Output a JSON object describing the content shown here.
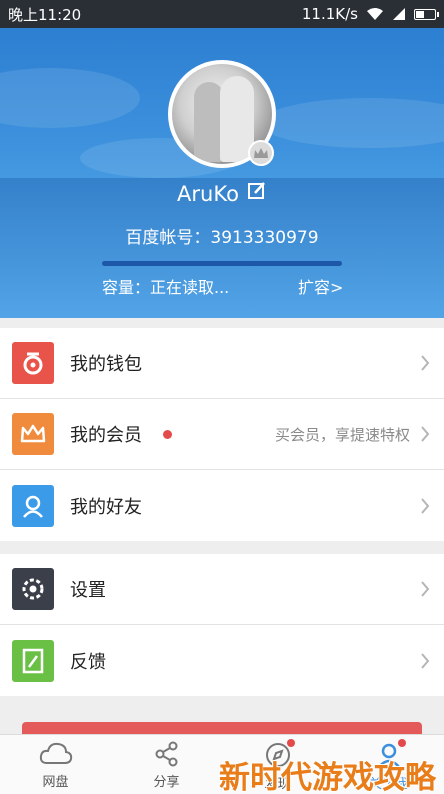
{
  "status_bar": {
    "time": "晚上11:20",
    "network_speed": "11.1K/s",
    "icons": [
      "wifi-icon",
      "signal-icon",
      "battery-icon"
    ]
  },
  "profile": {
    "username": "AruKo",
    "account_label": "百度帐号：3913330979",
    "quota_label": "容量：正在读取...",
    "expand_label": "扩容>",
    "quota_progress": 1.0,
    "quota_color": "#1d57a8"
  },
  "menu_group_1": [
    {
      "label": "我的钱包",
      "icon": "wallet-icon",
      "color": "#e8534a",
      "hint": "",
      "dot": false
    },
    {
      "label": "我的会员",
      "icon": "crown-icon",
      "color": "#f08a3c",
      "hint": "买会员，享提速特权",
      "dot": true
    },
    {
      "label": "我的好友",
      "icon": "friend-icon",
      "color": "#3b9be8",
      "hint": "",
      "dot": false
    }
  ],
  "menu_group_2": [
    {
      "label": "设置",
      "icon": "gear-icon",
      "color": "#3a3f4a",
      "hint": "",
      "dot": false
    },
    {
      "label": "反馈",
      "icon": "feedback-icon",
      "color": "#6abf45",
      "hint": "",
      "dot": false
    }
  ],
  "bottom_nav": [
    {
      "label": "网盘",
      "icon": "cloud-icon",
      "active": false,
      "dot": false
    },
    {
      "label": "分享",
      "icon": "share-icon",
      "active": false,
      "dot": false
    },
    {
      "label": "发现",
      "icon": "compass-icon",
      "active": false,
      "dot": true
    },
    {
      "label": "关于我",
      "icon": "person-icon",
      "active": true,
      "dot": true
    }
  ],
  "watermark": "新时代游戏攻略",
  "colors": {
    "accent": "#3b8fdc",
    "header_top": "#2d7fd1",
    "dot_red": "#e44a4a"
  }
}
